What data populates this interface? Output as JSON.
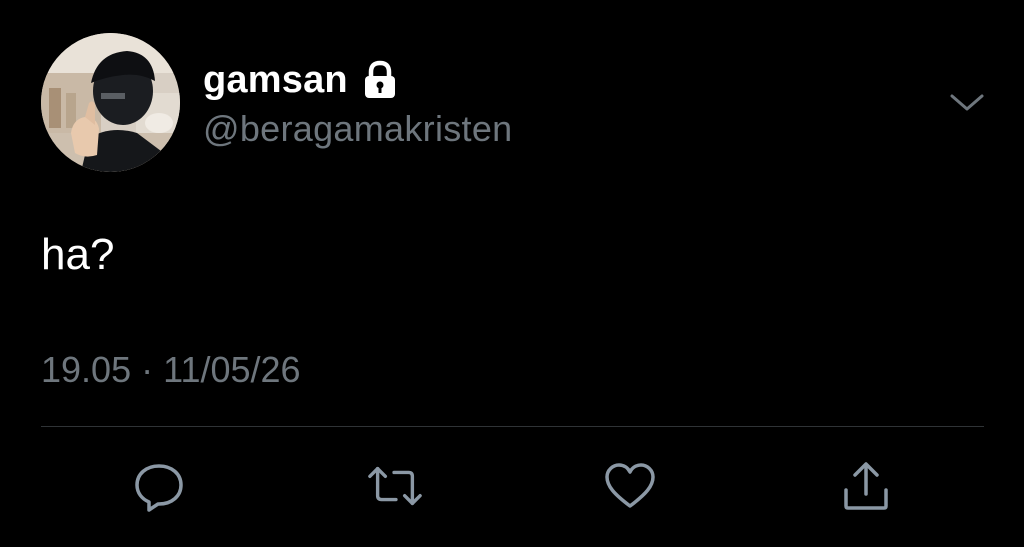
{
  "tweet": {
    "author": {
      "display_name": "gamsan",
      "handle": "@beragamakristen",
      "protected_icon": "lock-icon",
      "avatar_icon": "avatar-photo"
    },
    "text": "ha?",
    "time": "19.05",
    "separator": "·",
    "date": "11/05/26",
    "menu_icon": "chevron-down-icon",
    "actions": [
      {
        "name": "reply",
        "icon": "reply-icon"
      },
      {
        "name": "retweet",
        "icon": "retweet-icon"
      },
      {
        "name": "like",
        "icon": "heart-icon"
      },
      {
        "name": "share",
        "icon": "share-icon"
      }
    ]
  },
  "colors": {
    "background": "#000000",
    "primary_text": "#ffffff",
    "secondary_text": "#6e767d",
    "divider": "#2f3336",
    "icon": "#8b98a5"
  }
}
